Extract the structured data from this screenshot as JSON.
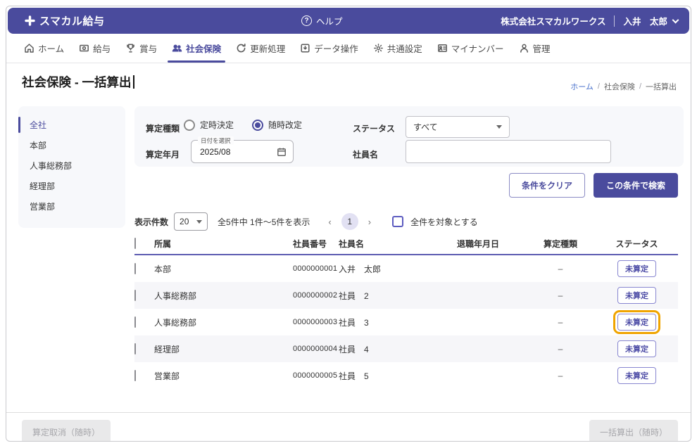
{
  "colors": {
    "primary": "#4a4b9d",
    "highlight_orange": "#f0a400",
    "link_blue": "#4a72cc",
    "chip_purple": "#4b4aa5"
  },
  "header": {
    "logo_text": "スマカル給与",
    "help_label": "ヘルプ",
    "company_name": "株式会社スマカルワークス",
    "user_name": "入井　太郎"
  },
  "nav": {
    "items": [
      {
        "label": "ホーム"
      },
      {
        "label": "給与"
      },
      {
        "label": "賞与"
      },
      {
        "label": "社会保険"
      },
      {
        "label": "更新処理"
      },
      {
        "label": "データ操作"
      },
      {
        "label": "共通設定"
      },
      {
        "label": "マイナンバー"
      },
      {
        "label": "管理"
      }
    ]
  },
  "page": {
    "title": "社会保険 - 一括算出",
    "breadcrumb": {
      "home": "ホーム",
      "separator": "/",
      "section": "社会保険",
      "current": "一括算出"
    }
  },
  "sidebar": {
    "items": [
      {
        "label": "全社"
      },
      {
        "label": "本部"
      },
      {
        "label": "人事総務部"
      },
      {
        "label": "経理部"
      },
      {
        "label": "営業部"
      }
    ]
  },
  "filters": {
    "calc_type_label": "算定種類",
    "radio_regular": "定時決定",
    "radio_occasional": "随時改定",
    "status_label": "ステータス",
    "status_value": "すべて",
    "calc_month_label": "算定年月",
    "date_field_label": "日付を選択",
    "date_value": "2025/08",
    "employee_name_label": "社員名",
    "employee_name_value": ""
  },
  "actions": {
    "clear_label": "条件をクリア",
    "search_label": "この条件で検索"
  },
  "pagination": {
    "page_size_label": "表示件数",
    "page_size_value": "20",
    "summary": "全5件中 1件〜5件を表示",
    "prev": "‹",
    "current_page": "1",
    "next": "›",
    "select_all_label": "全件を対象とする"
  },
  "table": {
    "headers": [
      "所属",
      "社員番号",
      "社員名",
      "退職年月日",
      "算定種類",
      "ステータス"
    ],
    "rows": [
      {
        "dept": "本部",
        "employee_no": "0000000001",
        "name": "入井　太郎",
        "retirement_date": "",
        "calc_type": "–",
        "status": "未算定"
      },
      {
        "dept": "人事総務部",
        "employee_no": "0000000002",
        "name": "社員　2",
        "retirement_date": "",
        "calc_type": "–",
        "status": "未算定"
      },
      {
        "dept": "人事総務部",
        "employee_no": "0000000003",
        "name": "社員　3",
        "retirement_date": "",
        "calc_type": "–",
        "status": "未算定"
      },
      {
        "dept": "経理部",
        "employee_no": "0000000004",
        "name": "社員　4",
        "retirement_date": "",
        "calc_type": "–",
        "status": "未算定"
      },
      {
        "dept": "営業部",
        "employee_no": "0000000005",
        "name": "社員　5",
        "retirement_date": "",
        "calc_type": "–",
        "status": "未算定"
      }
    ]
  },
  "footer": {
    "cancel_label": "算定取消（随時）",
    "submit_label": "一括算出（随時）"
  }
}
